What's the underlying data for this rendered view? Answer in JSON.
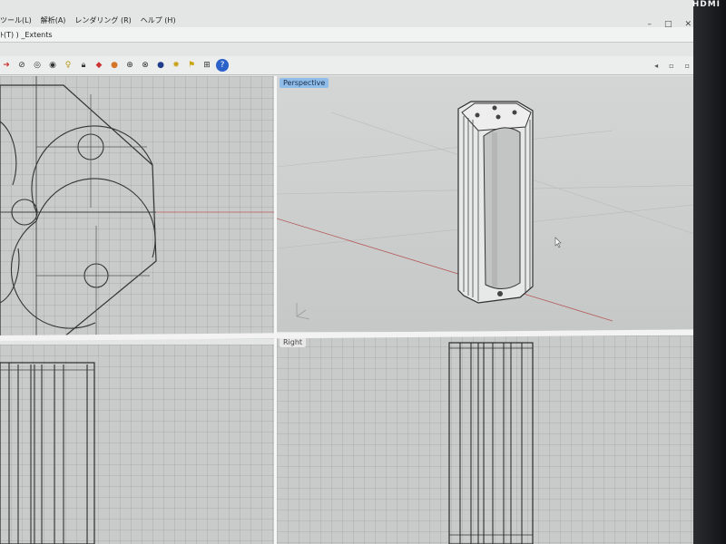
{
  "menubar": {
    "items": [
      "ツール(L)",
      "解析(A)",
      "レンダリング (R)",
      "ヘルプ (H)"
    ]
  },
  "window_controls": {
    "minimize": "–",
    "maximize": "□",
    "close": "✕"
  },
  "command": {
    "text": "ﾄ(T) ) _Extents"
  },
  "toolbar": {
    "icons": [
      "arrow-icon",
      "dim-icon",
      "view-icon",
      "eye-icon",
      "lamp-icon",
      "lock-icon",
      "palette-icon",
      "color-wheel-icon",
      "globe-icon",
      "sphere-icon",
      "render-icon",
      "gear-icon",
      "flag-icon",
      "dimension-icon",
      "help-icon"
    ],
    "right_glyphs": [
      "◂",
      "▫",
      "▫"
    ]
  },
  "viewports": {
    "top": {
      "label": ""
    },
    "perspective": {
      "label": "Perspective"
    },
    "front": {
      "label": ""
    },
    "right": {
      "label": "Right"
    }
  },
  "monitor": {
    "brand": "HDMI"
  },
  "colors": {
    "active_label": "#8fbce8",
    "viewport_bg": "#c9cbcb",
    "axis_red": "#b65a5a"
  }
}
